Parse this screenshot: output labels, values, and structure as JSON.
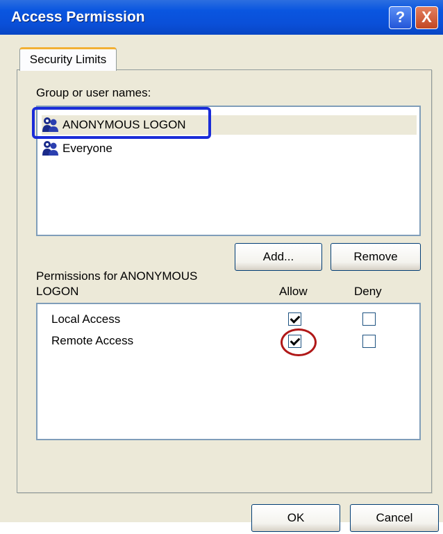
{
  "window": {
    "title": "Access Permission"
  },
  "titlebar_buttons": {
    "help": "?",
    "close": "X"
  },
  "tabs": [
    {
      "label": "Security Limits"
    }
  ],
  "group": {
    "label": "Group or user names:",
    "items": [
      {
        "name": "ANONYMOUS LOGON",
        "selected": true,
        "icon": "users-icon"
      },
      {
        "name": "Everyone",
        "selected": false,
        "icon": "users-icon"
      }
    ]
  },
  "buttons": {
    "add": "Add...",
    "remove": "Remove",
    "ok": "OK",
    "cancel": "Cancel"
  },
  "permissions": {
    "label_line1": "Permissions for ANONYMOUS",
    "label_line2": "LOGON",
    "allow_header": "Allow",
    "deny_header": "Deny",
    "rows": [
      {
        "name": "Local Access",
        "allow": true,
        "deny": false
      },
      {
        "name": "Remote Access",
        "allow": true,
        "deny": false
      }
    ]
  },
  "colors": {
    "titlebar": "#0a4fd8",
    "dialog_bg": "#ece9d8",
    "blue_highlight": "#1a2cd8",
    "red_highlight": "#b01818"
  }
}
